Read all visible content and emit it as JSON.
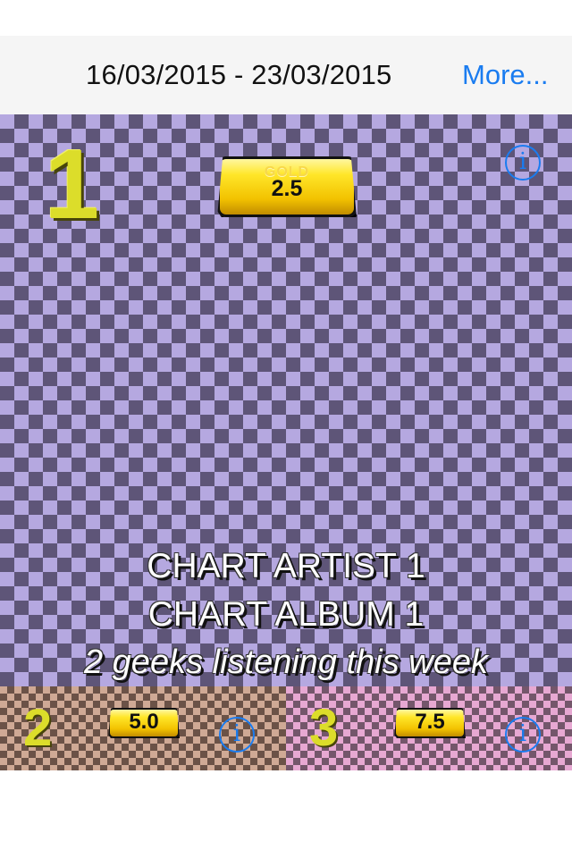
{
  "header": {
    "date_range": "16/03/2015 - 23/03/2015",
    "more_label": "More...",
    "link_color": "#1a7cf0"
  },
  "featured": {
    "rank": "1",
    "score": "2.5",
    "bar_engraving": "GOLD",
    "artist": "CHART ARTIST 1",
    "album": "CHART ALBUM 1",
    "listeners": "2 geeks listening this week",
    "info_icon": "info-circle-icon",
    "checker_colors": [
      "#b5a8e0",
      "#5e5578"
    ]
  },
  "entries": [
    {
      "rank": "2",
      "score": "5.0",
      "info_icon": "info-circle-icon",
      "checker_colors": [
        "#cfa995",
        "#6b5247"
      ]
    },
    {
      "rank": "3",
      "score": "7.5",
      "info_icon": "info-circle-icon",
      "checker_colors": [
        "#e7a8d2",
        "#74566b"
      ]
    }
  ],
  "rank_color": "#dcdd2a",
  "gold_color": "#f2c200"
}
